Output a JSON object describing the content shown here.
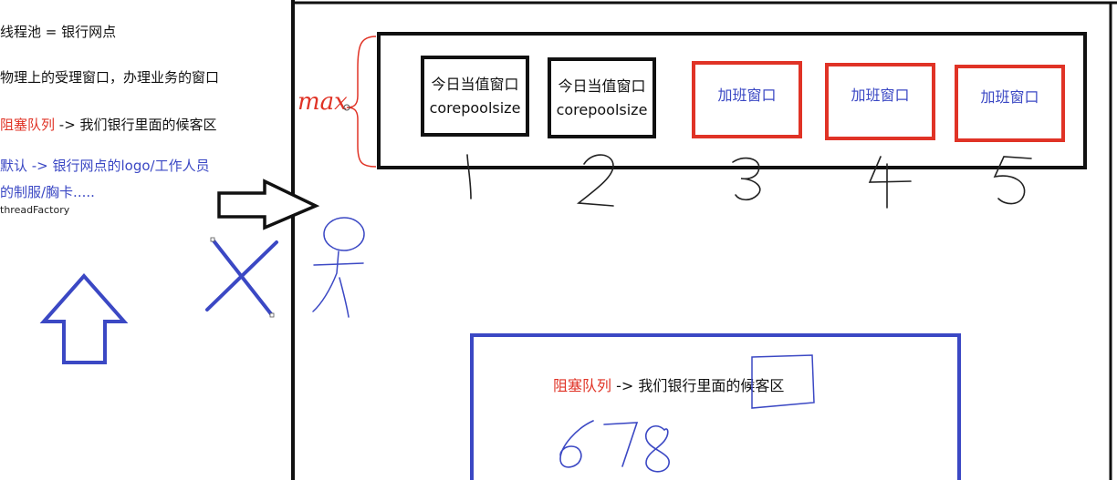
{
  "notes": {
    "line1": "线程池 = 银行网点",
    "line2": "物理上的受理窗口，办理业务的窗口",
    "line3_red": "阻塞队列",
    "line3_rest": " -> 我们银行里面的候客区",
    "line4": "默认 -> 银行网点的logo/工作人员",
    "line5": "的制服/胸卡.....",
    "line6": "threadFactory"
  },
  "windows": {
    "core": [
      {
        "line1": "今日当值窗口",
        "line2": "corepoolsize"
      },
      {
        "line1": "今日当值窗口",
        "line2": "corepoolsize"
      }
    ],
    "overtime": [
      {
        "label": "加班窗口"
      },
      {
        "label": "加班窗口"
      },
      {
        "label": "加班窗口"
      }
    ],
    "handwritten_numbers": [
      "1",
      "2",
      "3",
      "4",
      "5"
    ],
    "max_label": "max"
  },
  "queue": {
    "label_red": "阻塞队列",
    "label_rest": " -> 我们银行里面的候客区",
    "handwritten": "678"
  },
  "colors": {
    "black": "#111111",
    "red": "#e03326",
    "blue": "#3b48c4"
  }
}
